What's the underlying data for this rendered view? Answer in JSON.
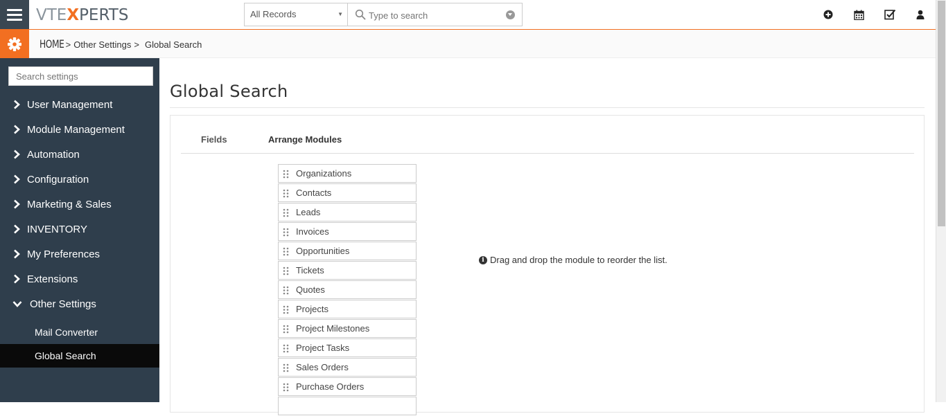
{
  "app": {
    "logo_prefix": "VTE",
    "logo_x": "X",
    "logo_suffix": "PERTS"
  },
  "topbar": {
    "records_select": "All Records",
    "search_placeholder": "Type to search",
    "icons": [
      "plus-circle-icon",
      "calendar-icon",
      "checkbox-icon",
      "user-icon"
    ]
  },
  "breadcrumb": {
    "home": "HOME",
    "sep": ">",
    "level1": "Other Settings",
    "level2": "Global Search"
  },
  "sidebar": {
    "search_placeholder": "Search settings",
    "items": [
      {
        "label": "User Management"
      },
      {
        "label": "Module Management"
      },
      {
        "label": "Automation"
      },
      {
        "label": "Configuration"
      },
      {
        "label": "Marketing & Sales"
      },
      {
        "label": "INVENTORY"
      },
      {
        "label": "My Preferences"
      },
      {
        "label": "Extensions"
      },
      {
        "label": "Other Settings"
      }
    ],
    "subitems": [
      {
        "label": "Mail Converter"
      },
      {
        "label": "Global Search"
      }
    ],
    "active_subitem": "Global Search"
  },
  "main": {
    "title": "Global Search",
    "tabs": [
      {
        "label": "Fields"
      },
      {
        "label": "Arrange Modules"
      }
    ],
    "active_tab": "Arrange Modules",
    "modules": [
      "Organizations",
      "Contacts",
      "Leads",
      "Invoices",
      "Opportunities",
      "Tickets",
      "Quotes",
      "Projects",
      "Project Milestones",
      "Project Tasks",
      "Sales Orders",
      "Purchase Orders"
    ],
    "info_text": "Drag and drop the module to reorder the list."
  },
  "colors": {
    "accent": "#f26f21",
    "sidebar_bg": "#2f3e4c",
    "sidebar_active": "#0a0a0a",
    "menu_btn": "#3a4752"
  }
}
